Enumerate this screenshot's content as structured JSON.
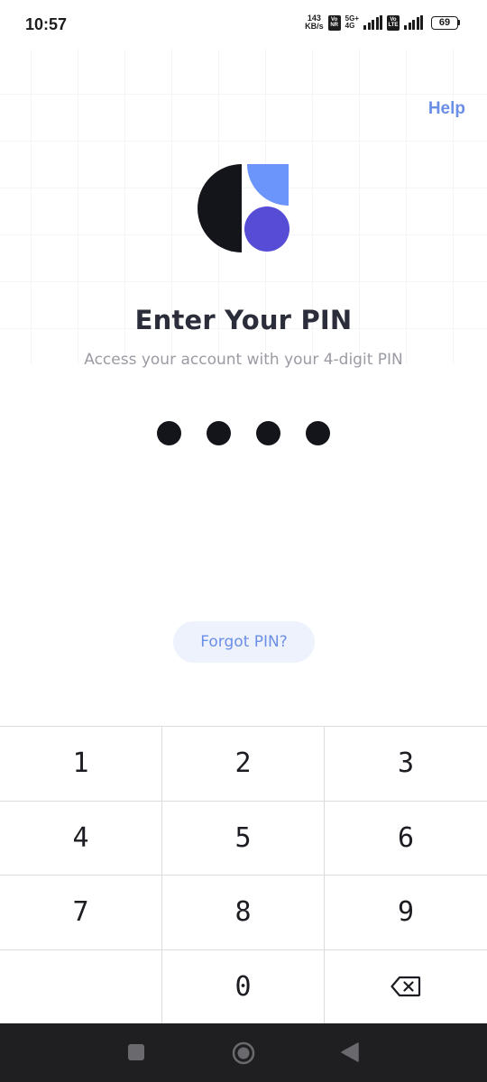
{
  "status_bar": {
    "time": "10:57",
    "net_speed_value": "143",
    "net_speed_unit": "KB/s",
    "vonr_top": "Vo",
    "vonr_bottom": "NR",
    "sim1_network": "5G+",
    "sim1_sub": "4G",
    "volte_top": "Vo",
    "volte_bottom": "LTE",
    "battery_level": "69"
  },
  "header": {
    "help_label": "Help"
  },
  "main": {
    "title": "Enter Your PIN",
    "subtitle": "Access your account with your 4-digit PIN",
    "pin_filled": 4,
    "pin_length": 4,
    "forgot_label": "Forgot PIN?"
  },
  "keypad": {
    "keys": [
      "1",
      "2",
      "3",
      "4",
      "5",
      "6",
      "7",
      "8",
      "9",
      "",
      "0",
      "backspace-icon"
    ]
  },
  "colors": {
    "accent": "#6b8fe6",
    "logo_dark": "#14141b",
    "logo_light_blue": "#6b95fa",
    "logo_purple": "#564cd6"
  }
}
